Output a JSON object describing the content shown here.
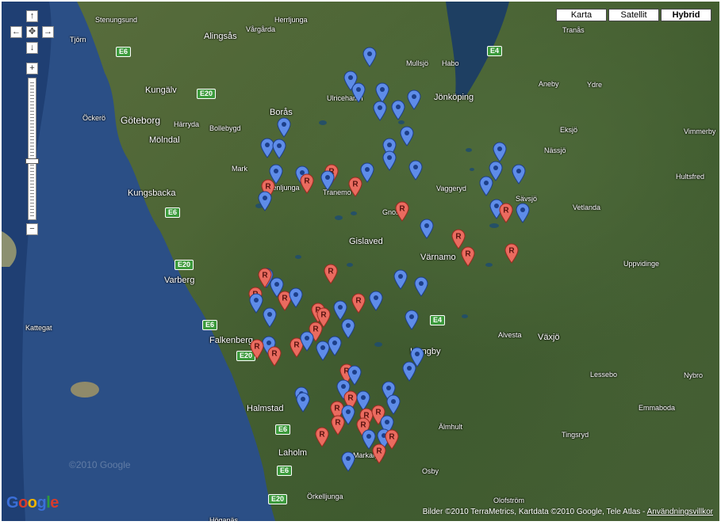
{
  "map_types": [
    {
      "label": "Karta",
      "active": false
    },
    {
      "label": "Satellit",
      "active": false
    },
    {
      "label": "Hybrid",
      "active": true
    }
  ],
  "controls": {
    "pan_up": "↑",
    "pan_left": "←",
    "pan_center": "✥",
    "pan_right": "→",
    "pan_down": "↓",
    "zoom_in": "+",
    "zoom_out": "−",
    "zoom_level_fraction": 0.6
  },
  "places": [
    {
      "name": "Stenungsund",
      "size": "small"
    },
    {
      "name": "Herrljunga",
      "size": "small"
    },
    {
      "name": "Vårgårda",
      "size": "small"
    },
    {
      "name": "Tjörn",
      "size": "small"
    },
    {
      "name": "Alingsås",
      "size": "normal"
    },
    {
      "name": "Kungälv",
      "size": "normal"
    },
    {
      "name": "Öckerö",
      "size": "small"
    },
    {
      "name": "Göteborg",
      "size": "big"
    },
    {
      "name": "Härryda",
      "size": "small"
    },
    {
      "name": "Bollebygd",
      "size": "small"
    },
    {
      "name": "Mölndal",
      "size": "normal"
    },
    {
      "name": "Borås",
      "size": "normal"
    },
    {
      "name": "Ulricehamn",
      "size": "small"
    },
    {
      "name": "Mullsjö",
      "size": "small"
    },
    {
      "name": "Habo",
      "size": "small"
    },
    {
      "name": "Jönköping",
      "size": "normal"
    },
    {
      "name": "Tranås",
      "size": "small"
    },
    {
      "name": "Aneby",
      "size": "small"
    },
    {
      "name": "Ydre",
      "size": "small"
    },
    {
      "name": "Eksjö",
      "size": "small"
    },
    {
      "name": "Vimmerby",
      "size": "small"
    },
    {
      "name": "Nässjö",
      "size": "small"
    },
    {
      "name": "Hultsfred",
      "size": "small"
    },
    {
      "name": "Mark",
      "size": "small"
    },
    {
      "name": "Kungsbacka",
      "size": "normal"
    },
    {
      "name": "Svenljunga",
      "size": "small"
    },
    {
      "name": "Tranemo",
      "size": "small"
    },
    {
      "name": "Vaggeryd",
      "size": "small"
    },
    {
      "name": "Sävsjö",
      "size": "small"
    },
    {
      "name": "Vetlanda",
      "size": "small"
    },
    {
      "name": "Gnosjö",
      "size": "small"
    },
    {
      "name": "Gislaved",
      "size": "normal"
    },
    {
      "name": "Värnamo",
      "size": "normal"
    },
    {
      "name": "Uppvidinge",
      "size": "small"
    },
    {
      "name": "Varberg",
      "size": "normal"
    },
    {
      "name": "Kattegat",
      "size": "small"
    },
    {
      "name": "Falkenberg",
      "size": "normal"
    },
    {
      "name": "Ljungby",
      "size": "normal"
    },
    {
      "name": "Alvesta",
      "size": "small"
    },
    {
      "name": "Växjö",
      "size": "normal"
    },
    {
      "name": "Lessebo",
      "size": "small"
    },
    {
      "name": "Nybro",
      "size": "small"
    },
    {
      "name": "Emmaboda",
      "size": "small"
    },
    {
      "name": "Halmstad",
      "size": "normal"
    },
    {
      "name": "Laholm",
      "size": "normal"
    },
    {
      "name": "Älmhult",
      "size": "small"
    },
    {
      "name": "Tingsryd",
      "size": "small"
    },
    {
      "name": "Markaryd",
      "size": "small"
    },
    {
      "name": "Osby",
      "size": "small"
    },
    {
      "name": "Örkelljunga",
      "size": "small"
    },
    {
      "name": "Olofström",
      "size": "small"
    },
    {
      "name": "Höganäs",
      "size": "small"
    }
  ],
  "roads": [
    "E6",
    "E4",
    "E20",
    "E6",
    "E20",
    "E6",
    "E20",
    "E6",
    "E4",
    "E6",
    "E20"
  ],
  "markers": {
    "blue_label": "",
    "red_label": "R"
  },
  "watermark": "©2010 Google",
  "attribution": {
    "text": "Bilder ©2010 TerraMetrics, Kartdata ©2010 Google, Tele Atlas - ",
    "link": "Användningsvillkor"
  },
  "logo": "Google",
  "colors": {
    "blue_marker": "#5e8ce8",
    "red_marker": "#ea6b5f",
    "sea": "#2b4f86"
  }
}
